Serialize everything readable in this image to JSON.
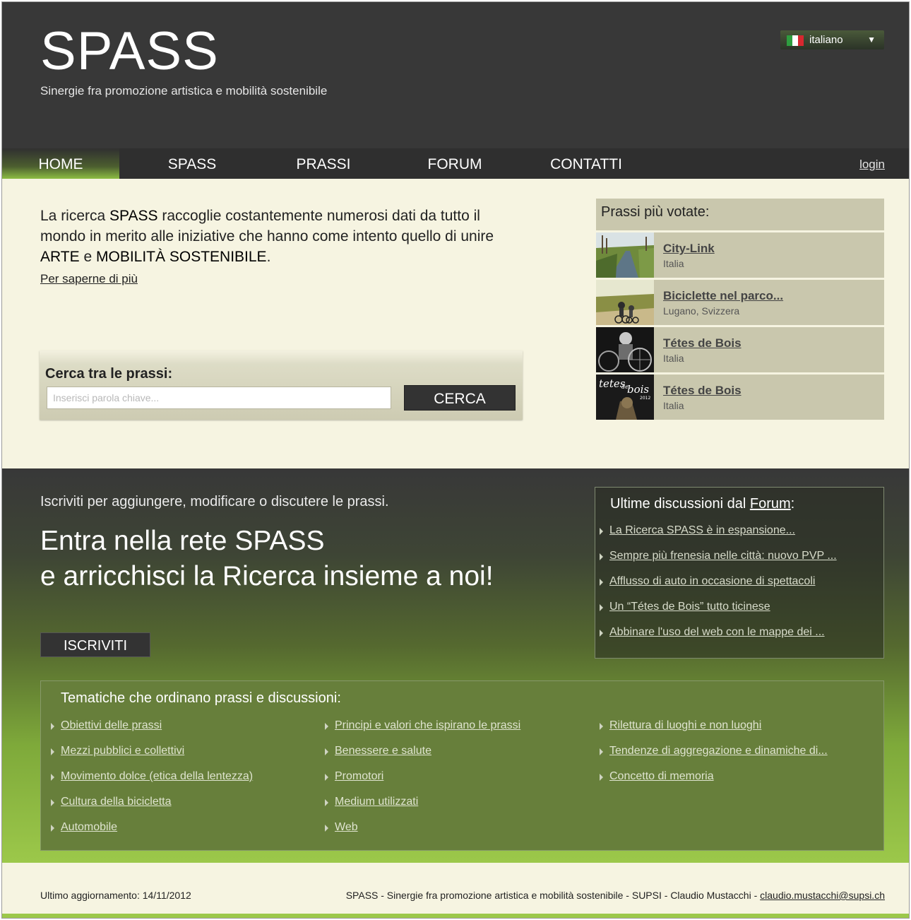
{
  "header": {
    "logo": "SPASS",
    "tagline": "Sinergie fra promozione artistica e mobilità sostenibile",
    "language": {
      "label": "italiano",
      "flag": "italy-flag-icon",
      "flag_colors": [
        "#2e9e3f",
        "#ffffff",
        "#d7282f"
      ]
    }
  },
  "nav": {
    "items": [
      "HOME",
      "SPASS",
      "PRASSI",
      "FORUM",
      "CONTATTI"
    ],
    "active": "HOME",
    "login": "login"
  },
  "intro": {
    "text_a": "La ricerca ",
    "spass": "SPASS",
    "text_b": " raccoglie costantemente numerosi dati da tutto il mondo in merito alle iniziative che hanno come intento quello di unire ",
    "arte": "ARTE",
    "text_c": " e ",
    "mobilita": "MOBILITÀ SOSTENIBILE",
    "text_d": ".",
    "link": "Per saperne di più"
  },
  "search": {
    "title": "Cerca tra le prassi:",
    "placeholder": "Inserisci parola chiave...",
    "button": "CERCA"
  },
  "voted": {
    "title": "Prassi più votate:",
    "items": [
      {
        "title": "City-Link",
        "subtitle": "Italia"
      },
      {
        "title": "Biciclette nel parco...",
        "subtitle": "Lugano, Svizzera"
      },
      {
        "title": "Tétes de Bois",
        "subtitle": "Italia"
      },
      {
        "title": "Tétes de Bois",
        "subtitle": "Italia"
      }
    ],
    "thumb4_text_a": "tetes",
    "thumb4_text_b": "de",
    "thumb4_text_c": "bois",
    "thumb4_year": "2012"
  },
  "join": {
    "small": "Iscriviti per aggiungere, modificare o discutere le prassi.",
    "line1": "Entra nella rete SPASS",
    "line2": "e arricchisci la Ricerca insieme a noi!",
    "button": "ISCRIVITI"
  },
  "forum": {
    "title_prefix": "Ultime discussioni dal ",
    "title_link": "Forum",
    "title_suffix": ":",
    "items": [
      "La Ricerca SPASS è in espansione...",
      "Sempre più frenesia nelle città: nuovo PVP ...",
      "Afflusso di auto in occasione di spettacoli",
      "Un “Tétes de Bois” tutto ticinese",
      "Abbinare l'uso del web con le mappe dei ..."
    ]
  },
  "topics": {
    "title": "Tematiche che ordinano prassi e discussioni:",
    "col1": [
      "Obiettivi delle prassi",
      "Mezzi pubblici e collettivi",
      "Movimento dolce (etica della lentezza)",
      "Cultura della bicicletta",
      "Automobile"
    ],
    "col2": [
      "Principi e valori che ispirano le prassi",
      "Benessere e salute",
      "Promotori",
      "Medium utilizzati",
      "Web"
    ],
    "col3": [
      "Rilettura di luoghi e non luoghi",
      "Tendenze di aggregazione e dinamiche di...",
      "Concetto di memoria"
    ]
  },
  "footer": {
    "updated": "Ultimo aggiornamento: 14/11/2012",
    "credits": "SPASS - Sinergie fra promozione artistica e mobilità sostenibile - SUPSI - Claudio Mustacchi - ",
    "email": "claudio.mustacchi@supsi.ch"
  },
  "colors": {
    "header_bg": "#383838",
    "accent_green": "#9cc84a",
    "cream_bg": "#f6f4e1",
    "panel_khaki": "#c9c7ad"
  }
}
